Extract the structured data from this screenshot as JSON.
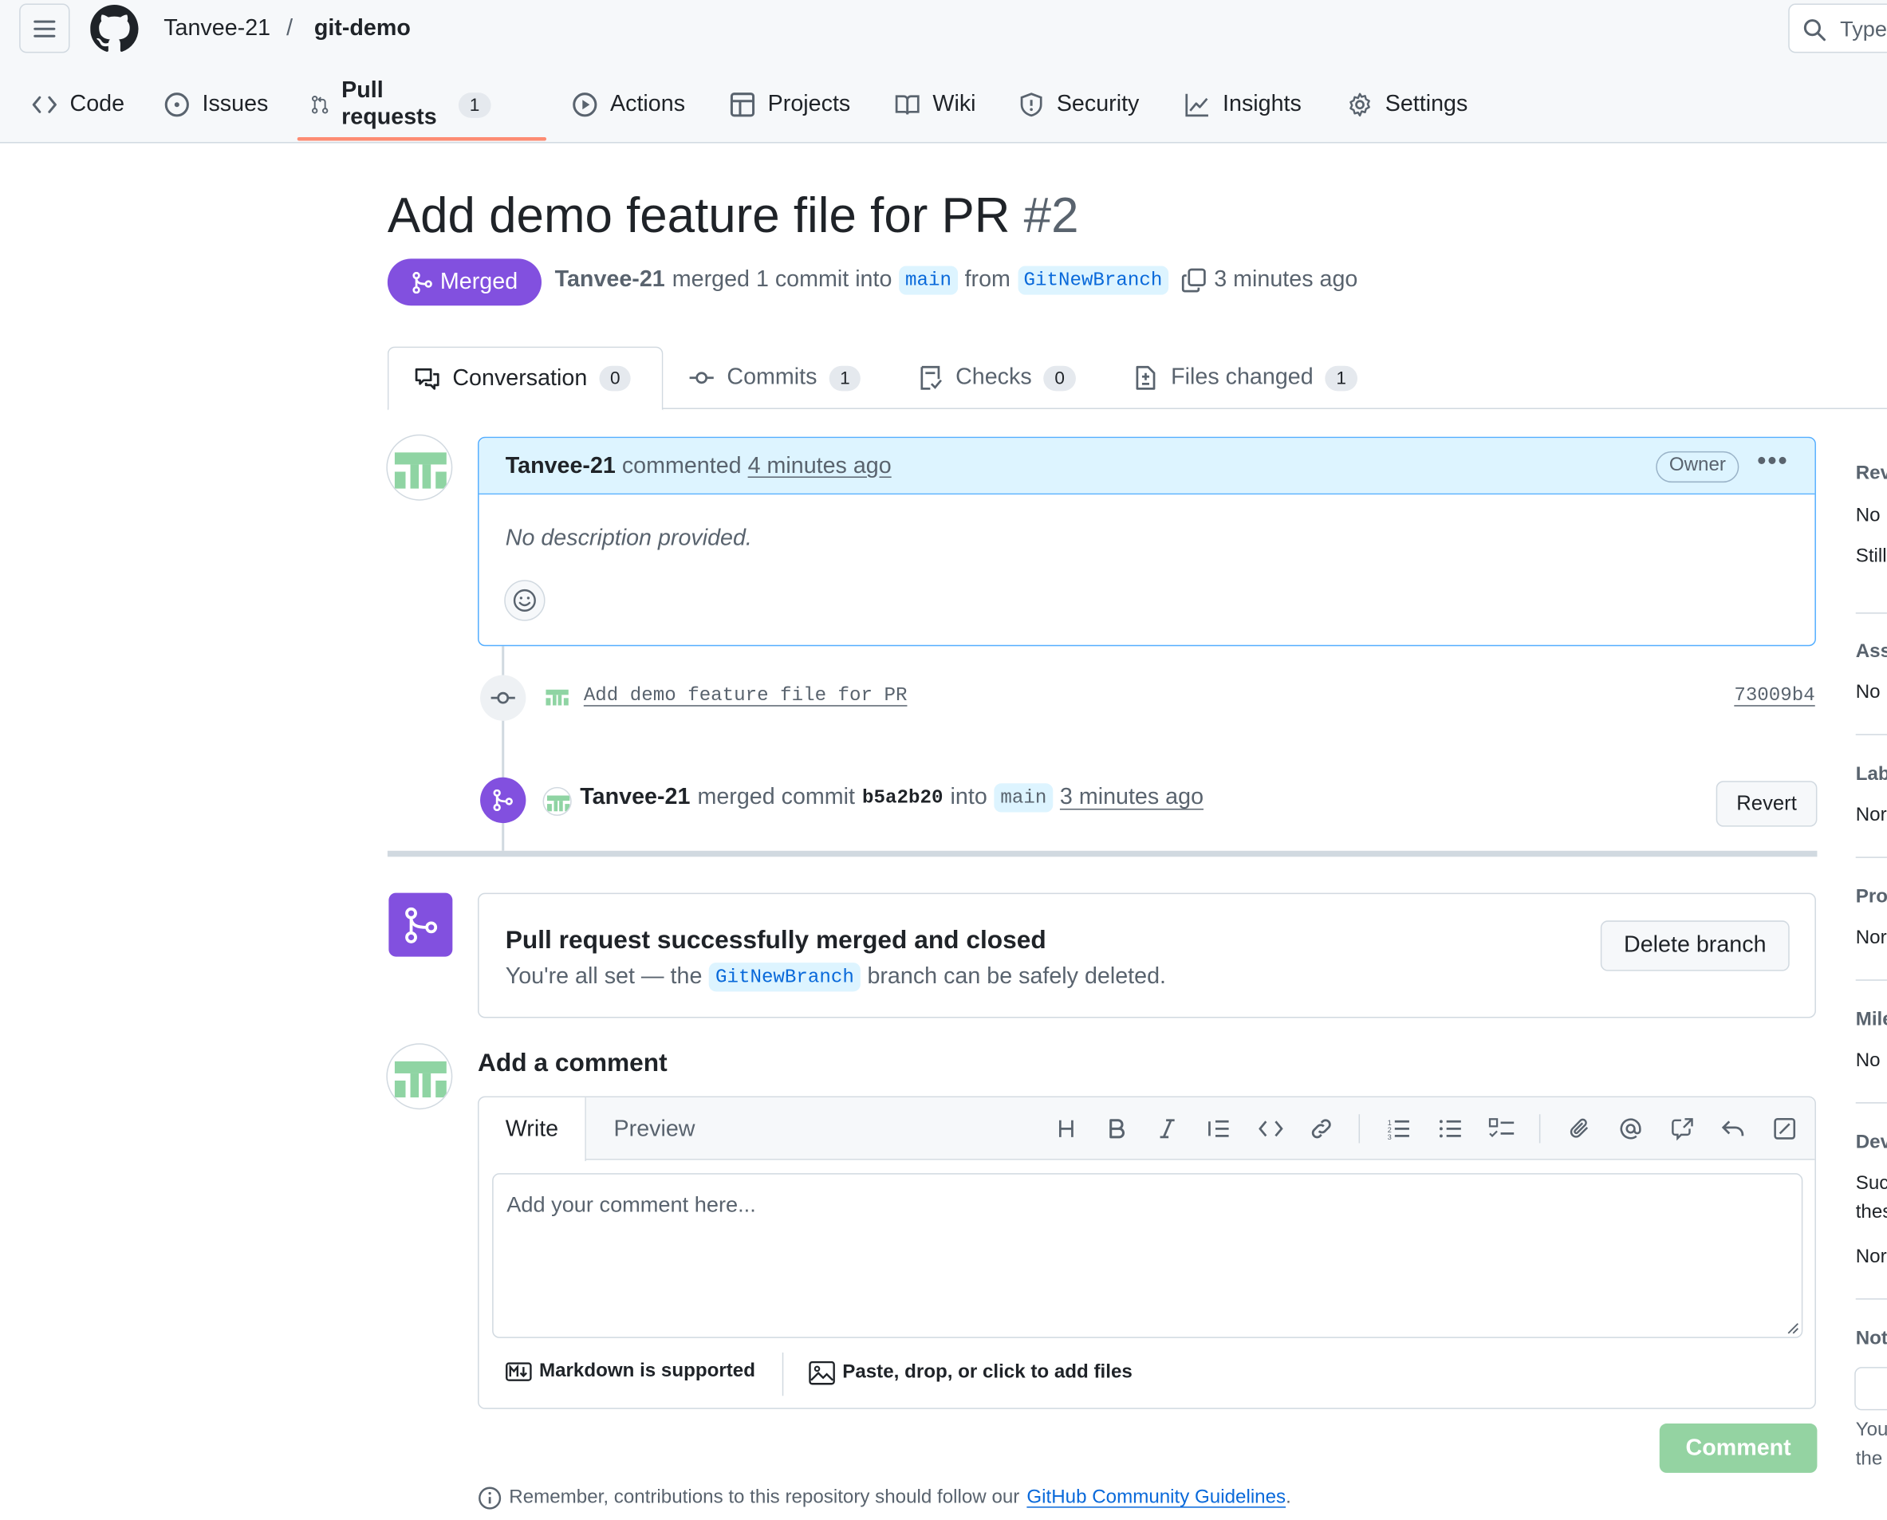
{
  "header": {
    "owner": "Tanvee-21",
    "separator": "/",
    "repo": "git-demo",
    "search_placeholder": "Type"
  },
  "repo_nav": [
    {
      "label": "Code",
      "icon": "code-icon"
    },
    {
      "label": "Issues",
      "icon": "issue-opened-icon"
    },
    {
      "label": "Pull requests",
      "icon": "git-pull-request-icon",
      "count": "1",
      "active": true
    },
    {
      "label": "Actions",
      "icon": "play-icon"
    },
    {
      "label": "Projects",
      "icon": "table-icon"
    },
    {
      "label": "Wiki",
      "icon": "book-icon"
    },
    {
      "label": "Security",
      "icon": "shield-icon"
    },
    {
      "label": "Insights",
      "icon": "graph-icon"
    },
    {
      "label": "Settings",
      "icon": "gear-icon"
    }
  ],
  "pr": {
    "title": "Add demo feature file for PR",
    "number": "#2",
    "state": "Merged",
    "author": "Tanvee-21",
    "merge_text": "merged 1 commit into",
    "base_branch": "main",
    "from_text": "from",
    "head_branch": "GitNewBranch",
    "time": "3 minutes ago"
  },
  "tabs": [
    {
      "label": "Conversation",
      "count": "0",
      "icon": "comment-discussion-icon"
    },
    {
      "label": "Commits",
      "count": "1",
      "icon": "git-commit-icon"
    },
    {
      "label": "Checks",
      "count": "0",
      "icon": "checklist-icon"
    },
    {
      "label": "Files changed",
      "count": "1",
      "icon": "file-diff-icon"
    }
  ],
  "comment": {
    "author": "Tanvee-21",
    "action": "commented",
    "time": "4 minutes ago",
    "role": "Owner",
    "body": "No description provided."
  },
  "commit": {
    "message": "Add demo feature file for PR",
    "sha": "73009b4"
  },
  "merge_event": {
    "author": "Tanvee-21",
    "text": "merged commit",
    "sha": "b5a2b20",
    "into": "into",
    "branch": "main",
    "time": "3 minutes ago",
    "revert_label": "Revert"
  },
  "merge_status": {
    "title": "Pull request successfully merged and closed",
    "desc_pre": "You're all set — the",
    "branch": "GitNewBranch",
    "desc_post": "branch can be safely deleted.",
    "delete_label": "Delete branch"
  },
  "add_comment": {
    "title": "Add a comment",
    "write_tab": "Write",
    "preview_tab": "Preview",
    "placeholder": "Add your comment here...",
    "markdown_note": "Markdown is supported",
    "attach_note": "Paste, drop, or click to add files",
    "submit_label": "Comment",
    "remember_pre": "Remember, contributions to this repository should follow our",
    "remember_link": "GitHub Community Guidelines",
    "remember_post": "."
  },
  "sidebar_clipped": {
    "reviewers_h": "Rev",
    "reviewers_v1": "No",
    "reviewers_v2": "Still",
    "assignees_h": "Ass",
    "assignees_v": "No",
    "labels_h": "Lab",
    "labels_v": "Nor",
    "projects_h": "Pro",
    "projects_v": "Nor",
    "milestone_h": "Mile",
    "milestone_v": "No",
    "development_h": "Dev",
    "development_v1": "Suc",
    "development_v2": "thes",
    "development_v3": "Nor",
    "notifications_h": "Not",
    "notifications_v1": "You",
    "notifications_v2": "the"
  },
  "colors": {
    "merged_purple": "#8250df",
    "link_blue": "#0969da",
    "nav_underline": "#fd8c73",
    "comment_header_bg": "#ddf4ff",
    "comment_button_disabled": "#94d3a2"
  }
}
